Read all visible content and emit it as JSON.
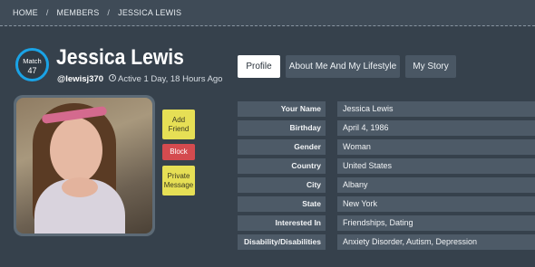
{
  "breadcrumb": [
    "HOME",
    "/",
    "MEMBERS",
    "/",
    "JESSICA LEWIS"
  ],
  "profile": {
    "match_label": "Match",
    "match_value": "47",
    "name": "Jessica Lewis",
    "username": "@lewisj370",
    "activity": "Active 1 Day, 18 Hours Ago"
  },
  "actions": {
    "add_friend": "Add Friend",
    "block": "Block",
    "private_message": "Private Message"
  },
  "tabs": [
    {
      "label": "Profile",
      "active": true
    },
    {
      "label": "About Me And My Lifestyle",
      "active": false
    },
    {
      "label": "My Story",
      "active": false
    }
  ],
  "details": [
    {
      "label": "Your Name",
      "value": "Jessica Lewis"
    },
    {
      "label": "Birthday",
      "value": "April 4, 1986"
    },
    {
      "label": "Gender",
      "value": "Woman"
    },
    {
      "label": "Country",
      "value": "United States"
    },
    {
      "label": "City",
      "value": "Albany"
    },
    {
      "label": "State",
      "value": "New York"
    },
    {
      "label": "Interested In",
      "value": "Friendships, Dating"
    },
    {
      "label": "Disability/Disabilities",
      "value": "Anxiety Disorder, Autism, Depression"
    }
  ],
  "colors": {
    "background": "#36414c",
    "match_ring": "#1aa3e6",
    "button_yellow": "#e6df55",
    "button_red": "#d44b4f"
  }
}
